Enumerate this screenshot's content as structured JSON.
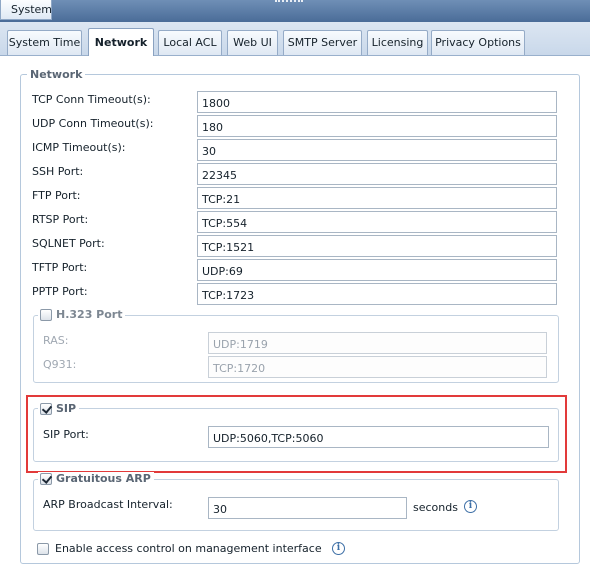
{
  "header": {
    "active_module": "System"
  },
  "tabs": [
    {
      "label": "System Time",
      "active": false
    },
    {
      "label": "Network",
      "active": true
    },
    {
      "label": "Local ACL",
      "active": false
    },
    {
      "label": "Web UI",
      "active": false
    },
    {
      "label": "SMTP Server",
      "active": false
    },
    {
      "label": "Licensing",
      "active": false
    },
    {
      "label": "Privacy Options",
      "active": false
    }
  ],
  "network": {
    "legend": "Network",
    "fields": [
      {
        "label": "TCP Conn Timeout(s):",
        "value": "1800"
      },
      {
        "label": "UDP Conn Timeout(s):",
        "value": "180"
      },
      {
        "label": "ICMP Timeout(s):",
        "value": "30"
      },
      {
        "label": "SSH Port:",
        "value": "22345"
      },
      {
        "label": "FTP Port:",
        "value": "TCP:21"
      },
      {
        "label": "RTSP Port:",
        "value": "TCP:554"
      },
      {
        "label": "SQLNET Port:",
        "value": "TCP:1521"
      },
      {
        "label": "TFTP Port:",
        "value": "UDP:69"
      },
      {
        "label": "PPTP Port:",
        "value": "TCP:1723"
      }
    ]
  },
  "h323": {
    "legend": "H.323 Port",
    "checked": false,
    "fields": [
      {
        "label": "RAS:",
        "value": "UDP:1719"
      },
      {
        "label": "Q931:",
        "value": "TCP:1720"
      }
    ]
  },
  "sip": {
    "legend": "SIP",
    "checked": true,
    "port_label": "SIP Port:",
    "port_value": "UDP:5060,TCP:5060"
  },
  "garp": {
    "legend": "Gratuitous ARP",
    "checked": true,
    "interval_label": "ARP Broadcast Interval:",
    "interval_value": "30",
    "unit": "seconds"
  },
  "access_control": {
    "label": "Enable access control on management interface",
    "checked": false
  },
  "icons": {
    "info": "info-icon",
    "check": "checkmark-icon"
  },
  "colors": {
    "highlight": "#e23a3a",
    "accent": "#4a6c98"
  }
}
